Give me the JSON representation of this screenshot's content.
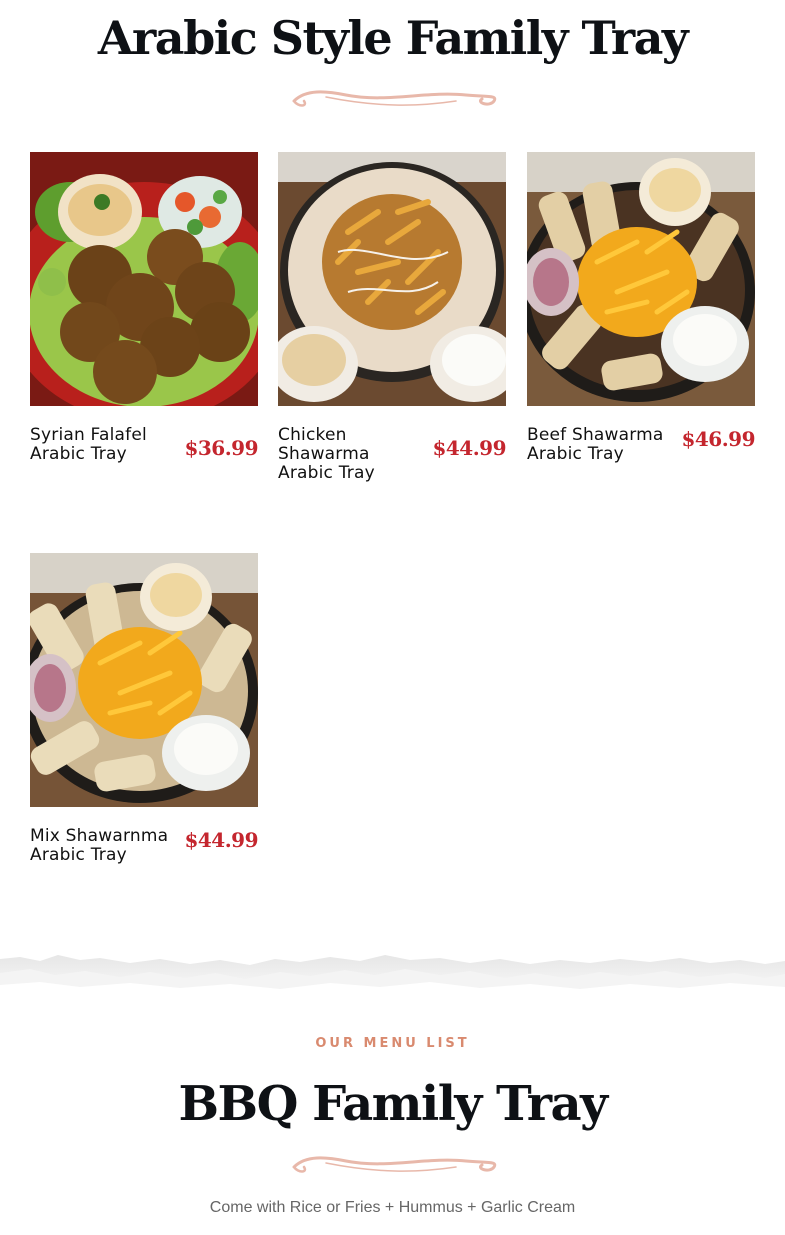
{
  "section_arabic": {
    "title": "Arabic Style Family Tray",
    "items": [
      {
        "name": "Syrian Falafel Arabic Tray",
        "price": "$36.99",
        "image": "falafel-plate-photo"
      },
      {
        "name": "Chicken Shawarma Arabic Tray",
        "price": "$44.99",
        "image": "chicken-shawarma-tray-photo"
      },
      {
        "name": "Beef Shawarma Arabic Tray",
        "price": "$46.99",
        "image": "beef-shawarma-tray-photo"
      },
      {
        "name": "Mix Shawarnma Arabic Tray",
        "price": "$44.99",
        "image": "mix-shawarma-tray-photo"
      }
    ]
  },
  "section_bbq": {
    "eyebrow": "OUR MENU LIST",
    "title": "BBQ Family Tray",
    "subtitle": "Come with Rice or Fries + Hummus + Garlic Cream"
  },
  "colors": {
    "title": "#0e1115",
    "price": "#c4262e",
    "accent_swash": "#e8b8aa",
    "eyebrow": "#d98a6f",
    "subtitle": "#666666"
  }
}
